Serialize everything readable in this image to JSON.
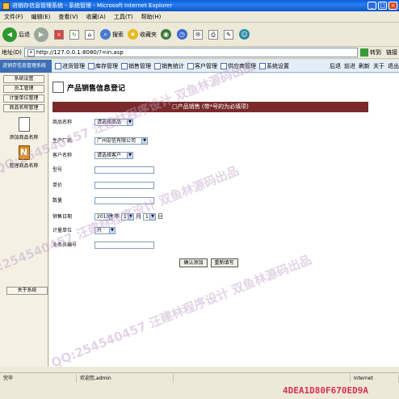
{
  "window": {
    "title": "进销存信息管理系统 - 系统管理 - Microsoft Internet Explorer",
    "min": "_",
    "max": "□",
    "close": "×"
  },
  "menu": [
    "文件(F)",
    "编辑(E)",
    "查看(V)",
    "收藏(A)",
    "工具(T)",
    "帮助(H)"
  ],
  "toolbar": {
    "back": "后退",
    "search": "搜索",
    "favorites": "收藏夹"
  },
  "address": {
    "label": "地址(D)",
    "url": "http://127.0.0.1:8080/?=in.asp",
    "go": "转到",
    "links": "链接"
  },
  "nav": {
    "brand": "进销存信息管理系统",
    "items": [
      "进货管理",
      "库存管理",
      "销售管理",
      "销售统计",
      "客户管理",
      "供应商管理",
      "系统设置"
    ],
    "right": [
      "后退",
      "前进",
      "刷新",
      "关于",
      "退出"
    ]
  },
  "sidebar": {
    "buttons": [
      "系统设置",
      "员工管理",
      "计量单位管理",
      "商品名称管理"
    ],
    "icons": [
      "添加商品名称",
      "管理商品名称"
    ],
    "footer": "关于系统"
  },
  "page": {
    "title": "产品销售信息登记",
    "form_header": "□产品销售 (带*号的为必填项)",
    "fields": {
      "product_name": {
        "label": "商品名称",
        "value": "请选择商品"
      },
      "supplier": {
        "label": "生产厂商",
        "value": "广州宏信有限公司"
      },
      "customer": {
        "label": "客户名称",
        "value": "请选择客户"
      },
      "spec": {
        "label": "型号"
      },
      "unit_price": {
        "label": "单价"
      },
      "quantity": {
        "label": "数量"
      },
      "sale_date": {
        "label": "销售日期",
        "year": "2010",
        "year_suffix": "年",
        "month": "1",
        "month_suffix": "月",
        "day": "1",
        "day_suffix": "日"
      },
      "unit": {
        "label": "计量单位",
        "value": "只"
      },
      "number": {
        "label": "业务员编号"
      }
    },
    "submit": "确认添加",
    "reset": "重新填写"
  },
  "status": {
    "left": "完毕",
    "user": "欢迎您,admin",
    "zone": "Internet"
  },
  "watermark": [
    "QQ:254540457 汪建林程序设计 双鱼林源码出品",
    "4DEA1D80F670ED9A"
  ]
}
